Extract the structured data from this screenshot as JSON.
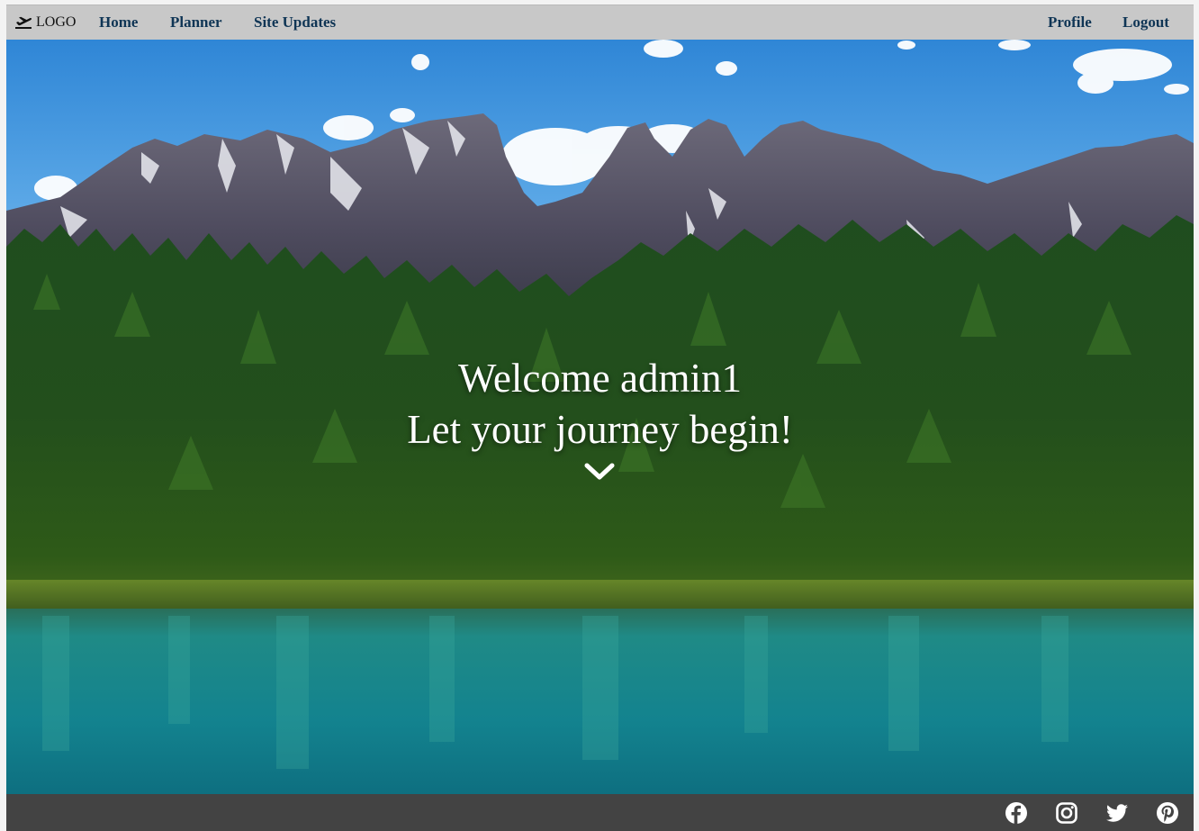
{
  "navbar": {
    "logo": {
      "icon": "airplane-departure-icon",
      "label": "LOGO"
    },
    "links_left": [
      "Home",
      "Planner",
      "Site Updates"
    ],
    "links_right": [
      "Profile",
      "Logout"
    ],
    "background": "#c8c8c8",
    "link_color": "#0f3555"
  },
  "hero": {
    "welcome": "Welcome admin1",
    "tagline": "Let your journey begin!",
    "scroll_icon": "chevron-down-icon",
    "background_image": "mountain lake with pine forest"
  },
  "footer": {
    "background": "#434343",
    "social_icons": [
      "facebook-icon",
      "instagram-icon",
      "twitter-icon",
      "pinterest-icon"
    ]
  }
}
